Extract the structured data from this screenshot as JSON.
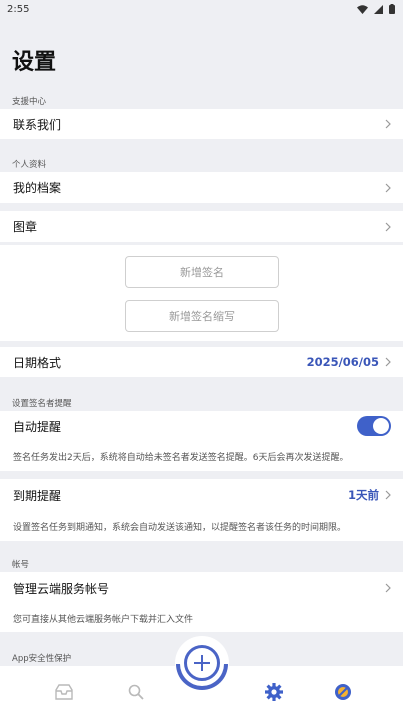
{
  "status_bar": {
    "time": "2:55"
  },
  "page_title": "设置",
  "sections": {
    "support": {
      "label": "支援中心",
      "contact": "联系我们"
    },
    "profile": {
      "label": "个人资料",
      "my_profile": "我的档案",
      "seal": "图章"
    },
    "signature": {
      "add_signature": "新增签名",
      "add_initials": "新增签名缩写"
    },
    "date_format": {
      "label": "日期格式",
      "value": "2025/06/05"
    },
    "reminder": {
      "label": "设置签名者提醒",
      "auto_reminder": "自动提醒",
      "auto_reminder_on": true,
      "auto_note": "签名任务发出2天后，系统将自动给未签名者发送签名提醒。6天后会再次发送提醒。",
      "expiry": "到期提醒",
      "expiry_value": "1天前",
      "expiry_note": "设置签名任务到期通知，系统会自动发送该通知，以提醒签名者该任务的时间期限。"
    },
    "account": {
      "label": "帐号",
      "manage_cloud": "管理云端服务帐号",
      "cloud_note": "您可直接从其他云端服务帐户下载并汇入文件"
    },
    "app_security": {
      "label": "App安全性保护"
    }
  },
  "colors": {
    "accent": "#3f61c9",
    "background": "#eeeff3"
  },
  "bottom_nav": {
    "items": [
      "inbox-icon",
      "search-icon",
      "add-icon",
      "settings-icon",
      "profile-icon"
    ],
    "active": "settings-icon"
  }
}
